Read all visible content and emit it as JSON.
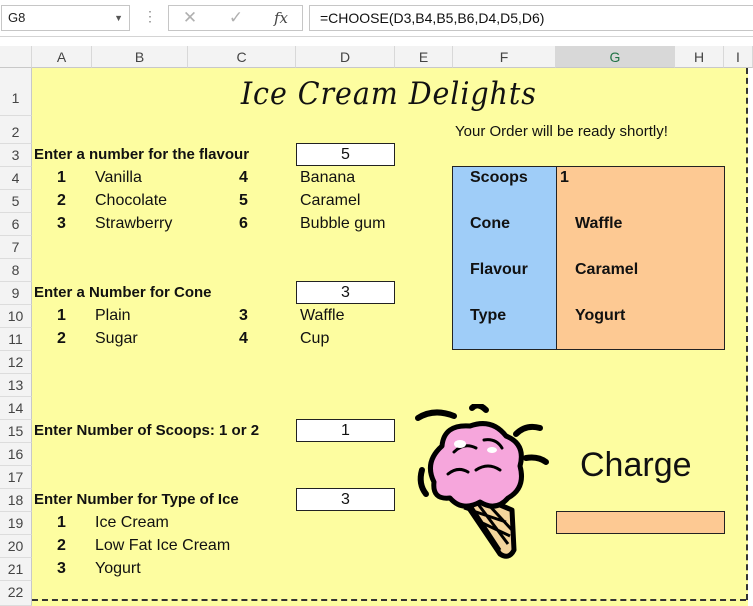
{
  "formula_bar": {
    "name_box": "G8",
    "cancel_icon": "✕",
    "enter_icon": "✓",
    "fx_label": "fx",
    "formula": "=CHOOSE(D3,B4,B5,B6,D4,D5,D6)"
  },
  "columns": [
    "A",
    "B",
    "C",
    "D",
    "E",
    "F",
    "G",
    "H",
    "I"
  ],
  "rows": [
    "1",
    "2",
    "3",
    "4",
    "5",
    "6",
    "7",
    "8",
    "9",
    "10",
    "11",
    "12",
    "13",
    "14",
    "15",
    "16",
    "17",
    "18",
    "19",
    "20",
    "21",
    "22"
  ],
  "sheet": {
    "title": "Ice Cream Delights",
    "order_message": "Your Order will be ready shortly!",
    "flavour": {
      "prompt": "Enter a number for the flavour",
      "value": "5",
      "options": [
        {
          "num": "1",
          "name": "Vanilla"
        },
        {
          "num": "2",
          "name": "Chocolate"
        },
        {
          "num": "3",
          "name": "Strawberry"
        },
        {
          "num": "4",
          "name": "Banana"
        },
        {
          "num": "5",
          "name": "Caramel"
        },
        {
          "num": "6",
          "name": "Bubble gum"
        }
      ]
    },
    "cone": {
      "prompt": "Enter a Number for Cone",
      "value": "3",
      "options": [
        {
          "num": "1",
          "name": "Plain"
        },
        {
          "num": "2",
          "name": "Sugar"
        },
        {
          "num": "3",
          "name": "Waffle"
        },
        {
          "num": "4",
          "name": "Cup"
        }
      ]
    },
    "scoops": {
      "prompt": "Enter Number of Scoops: 1 or 2",
      "value": "1"
    },
    "type": {
      "prompt": "Enter Number for Type of Ice",
      "value": "3",
      "options": [
        {
          "num": "1",
          "name": "Ice Cream"
        },
        {
          "num": "2",
          "name": "Low Fat Ice Cream"
        },
        {
          "num": "3",
          "name": "Yogurt"
        }
      ]
    },
    "summary": {
      "scoops_label": "Scoops",
      "scoops_value": "1",
      "cone_label": "Cone",
      "cone_value": "Waffle",
      "flavour_label": "Flavour",
      "flavour_value": "Caramel",
      "type_label": "Type",
      "type_value": "Yogurt"
    },
    "charge_label": "Charge",
    "image": "ice-cream-cone-icon"
  },
  "colors": {
    "sheet_bg": "#fdfda0",
    "panel_blue": "#9fcdf8",
    "panel_orange": "#fdc993",
    "ice_cream_pink": "#f6a6dc",
    "cone_tan": "#f4d59c"
  }
}
